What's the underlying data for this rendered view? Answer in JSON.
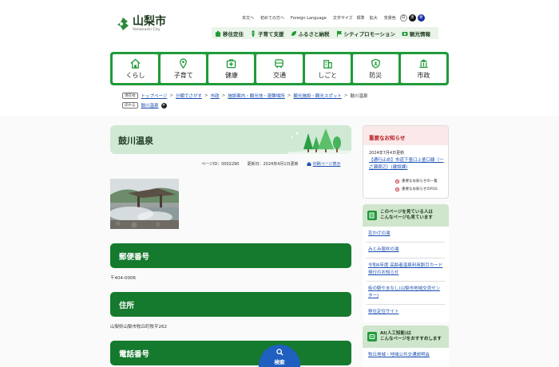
{
  "header": {
    "logo_title": "山梨市",
    "logo_sub": "Yamanashi City",
    "util": {
      "home": "本文へ",
      "first_time": "初めての方へ",
      "foreign": "Foreign Language",
      "font_size_label": "文字サイズ",
      "font_standard": "標準",
      "font_large": "拡大",
      "color_label": "背景色",
      "color_white": "白",
      "color_black": "黒",
      "color_blue": "青"
    },
    "topnav": [
      {
        "label": "移住定住",
        "icon": "house-icon"
      },
      {
        "label": "子育て支援",
        "icon": "child-icon"
      },
      {
        "label": "ふるさと納税",
        "icon": "leaf-icon"
      },
      {
        "label": "シティプロモーション",
        "icon": "flag-icon"
      },
      {
        "label": "観光情報",
        "icon": "camera-icon"
      }
    ]
  },
  "mainnav": [
    {
      "label": "くらし",
      "icon": "house-icon"
    },
    {
      "label": "子育て",
      "icon": "map-pin-icon"
    },
    {
      "label": "健康",
      "icon": "first-aid-icon"
    },
    {
      "label": "交通",
      "icon": "bus-icon"
    },
    {
      "label": "しごと",
      "icon": "building-icon"
    },
    {
      "label": "防災",
      "icon": "shield-icon"
    },
    {
      "label": "市政",
      "icon": "city-hall-icon"
    }
  ],
  "breadcrumb": {
    "tag": "現在地",
    "items": [
      "トップページ",
      "分類でさがす",
      "市政",
      "施設案内・観光地・避難場所",
      "観光施設・観光スポット"
    ],
    "current": "鼓川温泉",
    "tag2": "戻れる",
    "history": "鼓川温泉"
  },
  "page": {
    "title": "鼓川温泉",
    "page_id": "ページID：0002290",
    "updated": "更新日：2024年4月1日更新",
    "print": "印刷ページ表示"
  },
  "sections": [
    {
      "heading": "郵便番号",
      "text": "〒404-0006"
    },
    {
      "heading": "住所",
      "text": "山梨県山梨市牧丘町牧平262"
    },
    {
      "heading": "電話番号",
      "text": ""
    }
  ],
  "search_button": "検索",
  "sidebar": {
    "notice": {
      "heading": "重要なお知らせ",
      "date": "2024年7月4日更新",
      "link": "【通行止め】市道下釜口上釜口線（一之瀬周辺）(建設課)",
      "more1": "重要なお知らせの一覧",
      "more2": "重要なお知らせのRSS"
    },
    "also_viewed": {
      "heading_line1": "このページを見ている人は",
      "heading_line2": "こんなページも見ています",
      "items": [
        "花かげの湯",
        "みとみ笛吹の湯",
        "令和6年度 高齢者温泉利用割引カード発行のお知らせ",
        "街の駅やまなし(山梨市地域交流センター)",
        "移住定住サイト"
      ]
    },
    "ai_recommend": {
      "heading_line1": "AI(人工知能)は",
      "heading_line2": "こんなページをおすすめします",
      "items": [
        "牧丘地域・地域公共交通説明会"
      ]
    }
  },
  "colors": {
    "green_primary": "#1f9b3a",
    "green_dark": "#157a2d",
    "green_light": "#cfe9d4",
    "link_blue": "#1a4fb0",
    "alert_red": "#b3171f",
    "search_blue": "#1f5fbf"
  }
}
